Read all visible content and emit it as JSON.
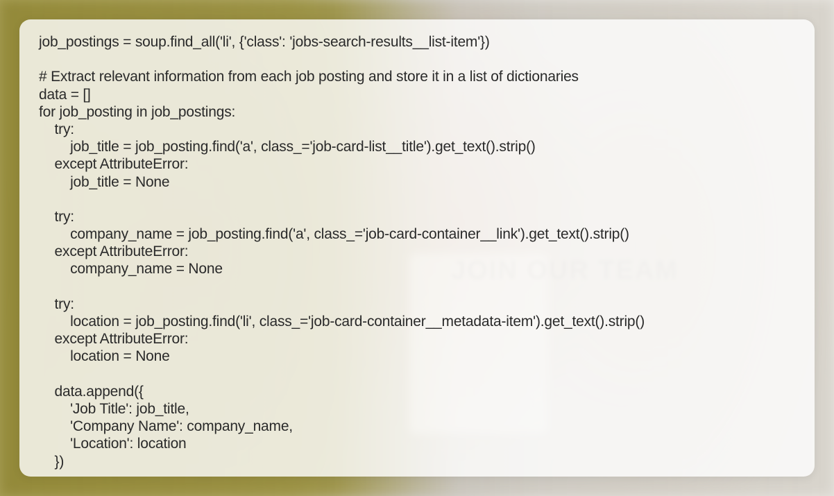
{
  "background": {
    "clipboard_text": "JOIN\nOUR\nTEAM"
  },
  "code": {
    "line1": "job_postings = soup.find_all('li', {'class': 'jobs-search-results__list-item'})",
    "line2": "",
    "line3": "# Extract relevant information from each job posting and store it in a list of dictionaries",
    "line4": "data = []",
    "line5": "for job_posting in job_postings:",
    "line6": "    try:",
    "line7": "        job_title = job_posting.find('a', class_='job-card-list__title').get_text().strip()",
    "line8": "    except AttributeError:",
    "line9": "        job_title = None",
    "line10": "",
    "line11": "    try:",
    "line12": "        company_name = job_posting.find('a', class_='job-card-container__link').get_text().strip()",
    "line13": "    except AttributeError:",
    "line14": "        company_name = None",
    "line15": "",
    "line16": "    try:",
    "line17": "        location = job_posting.find('li', class_='job-card-container__metadata-item').get_text().strip()",
    "line18": "    except AttributeError:",
    "line19": "        location = None",
    "line20": "",
    "line21": "    data.append({",
    "line22": "        'Job Title': job_title,",
    "line23": "        'Company Name': company_name,",
    "line24": "        'Location': location",
    "line25": "    })"
  }
}
